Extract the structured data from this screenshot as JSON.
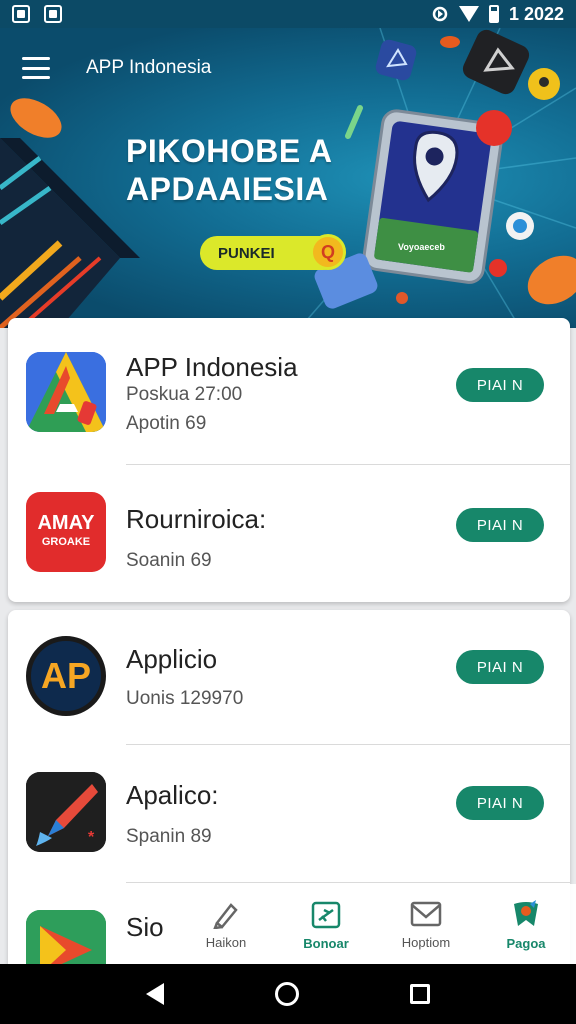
{
  "status": {
    "time": "1 2022"
  },
  "appbar": {
    "title": "APP Indonesia"
  },
  "hero": {
    "line1": "PIKOHOBE A",
    "line2": "APDAAIESIA",
    "pill": "PUNKEI",
    "pill_badge": "Q",
    "tile_text": "Voyoaeceb"
  },
  "cards": [
    {
      "items": [
        {
          "title": "APP Indonesia",
          "line1": "Poskua 27:00",
          "line2": "Apotin 69",
          "button": "PIAI N",
          "icon": "a-triangle-icon"
        },
        {
          "title": "Rourniroica:",
          "line1": "",
          "line2": "Soanin 69",
          "button": "PIAI N",
          "icon": "amay-logo-icon",
          "icon_text1": "AMAY",
          "icon_text2": "GROAKE"
        }
      ]
    },
    {
      "items": [
        {
          "title": "Applicio",
          "line1": "",
          "line2": "Uonis 129970",
          "button": "PIAI N",
          "icon": "ap-circle-icon",
          "icon_text": "AP"
        },
        {
          "title": "Apalico:",
          "line1": "",
          "line2": "Spanin 89",
          "button": "PIAI N",
          "icon": "rocket-icon"
        },
        {
          "title": "Sio",
          "line1": "",
          "line2": "",
          "button": "",
          "icon": "play-triangle-icon"
        }
      ]
    }
  ],
  "bottom_nav": [
    {
      "label": "Haikon",
      "icon": "pen-icon",
      "active": false
    },
    {
      "label": "Bonoar",
      "icon": "airplane-icon",
      "active": true
    },
    {
      "label": "Hoptiom",
      "icon": "mail-icon",
      "active": false
    },
    {
      "label": "Pagoa",
      "icon": "badge-icon",
      "active": true
    }
  ],
  "colors": {
    "accent": "#17876a",
    "hero_dark": "#0b4c6c",
    "hero_light": "#1e8fb5",
    "pill": "#dbe82a"
  }
}
